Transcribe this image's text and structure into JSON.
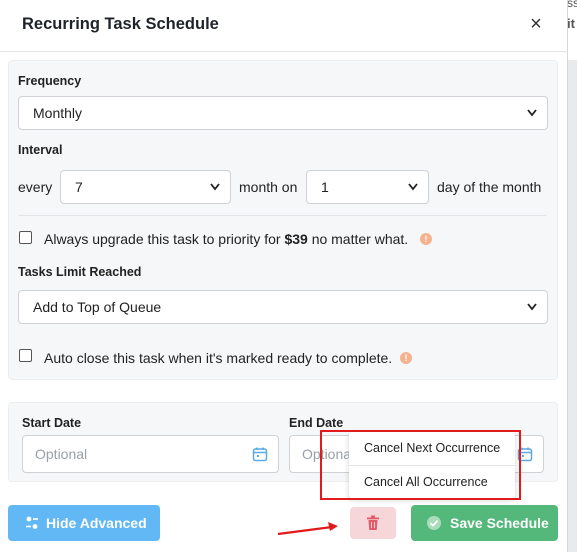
{
  "background": {
    "peek_text_1": "ss",
    "peek_text_2": "it"
  },
  "modal": {
    "title": "Recurring Task Schedule",
    "close_symbol": "×"
  },
  "frequency": {
    "label": "Frequency",
    "value": "Monthly"
  },
  "interval": {
    "label": "Interval",
    "prefix": "every",
    "every_value": "7",
    "middle": "month on",
    "day_value": "1",
    "suffix": "day of the month"
  },
  "upgrade": {
    "checked": false,
    "text_before": "Always upgrade this task to priority for",
    "price": "$39",
    "text_after": "no matter what.",
    "icon": "warning-icon"
  },
  "tasks_limit": {
    "label": "Tasks Limit Reached",
    "value": "Add to Top of Queue"
  },
  "auto_close": {
    "checked": false,
    "text": "Auto close this task when it's marked ready to complete.",
    "icon": "warning-icon"
  },
  "dates": {
    "start_label": "Start Date",
    "start_placeholder": "Optional",
    "end_label": "End Date",
    "end_placeholder": "Optiona"
  },
  "dropdown": {
    "items": [
      "Cancel Next Occurrence",
      "Cancel All Occurrence"
    ]
  },
  "footer": {
    "hide_advanced_label": "Hide Advanced",
    "save_label": "Save Schedule"
  },
  "colors": {
    "blue_button": "#62b8f4",
    "green_button": "#54b87a",
    "trash_button": "#f6d6d9",
    "highlight_border": "#e11b1b",
    "calendar_icon": "#5aa9e6",
    "warning_icon": "#f6b28e"
  }
}
